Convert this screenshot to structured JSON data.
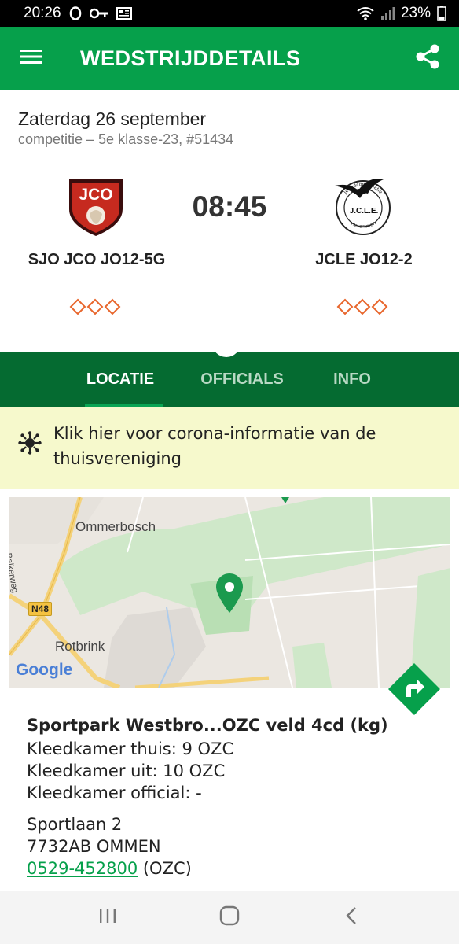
{
  "status": {
    "time": "20:26",
    "battery": "23%"
  },
  "app_bar": {
    "title": "WEDSTRIJDDETAILS"
  },
  "match": {
    "date": "Zaterdag 26 september",
    "subtitle": "competitie – 5e klasse-23, #51434",
    "time": "08:45",
    "home": {
      "name": "SJO JCO JO12-5G",
      "logo_text": "JCO"
    },
    "away": {
      "name": "JCLE JO12-2",
      "logo_text": "J.C.L.E.",
      "logo_ring_top": "Jeugdcombinatie",
      "logo_ring_bottom": "v.v. emmen"
    }
  },
  "tabs": [
    {
      "label": "LOCATIE",
      "active": true
    },
    {
      "label": "OFFICIALS",
      "active": false
    },
    {
      "label": "INFO",
      "active": false
    }
  ],
  "corona": {
    "text": "Klik hier voor corona-informatie van de thuisvereniging"
  },
  "map": {
    "labels": {
      "ommerbosch": "Ommerbosch",
      "rotbrink": "Rotbrink",
      "balkerweg": "Balkerweg",
      "road": "N48",
      "google": "Google"
    }
  },
  "location": {
    "title": "Sportpark Westbro...OZC veld 4cd (kg)",
    "dressing_home": "Kleedkamer thuis:  9 OZC",
    "dressing_away": "Kleedkamer uit:  10 OZC",
    "dressing_official": "Kleedkamer official:  -",
    "street": "Sportlaan 2",
    "postal_city": "7732AB OMMEN",
    "phone": "0529-452800",
    "phone_suffix": " (OZC)"
  },
  "colors": {
    "primary": "#06a04b",
    "tab_bar": "#056b31",
    "corona_bg": "#f6f9cc",
    "form_diamond": "#e8662c"
  },
  "icons": {
    "menu": "menu-icon",
    "share": "share-icon",
    "virus": "virus-icon",
    "map_pin": "map-pin-icon",
    "directions": "directions-icon"
  }
}
